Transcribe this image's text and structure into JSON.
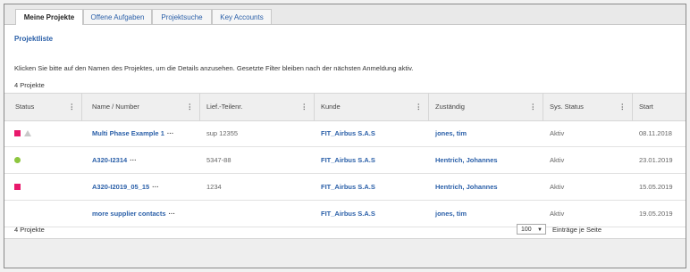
{
  "tabs": [
    "Meine Projekte",
    "Offene Aufgaben",
    "Projektsuche",
    "Key Accounts"
  ],
  "subtitle": "Projektliste",
  "info_text": "Klicken Sie bitte auf den Namen des Projektes, um die Details anzusehen. Gesetzte Filter bleiben nach der nächsten Anmeldung aktiv.",
  "count_text": "4 Projekte",
  "columns": [
    "Status",
    "Name / Number",
    "Lief.-Teilenr.",
    "Kunde",
    "Zuständig",
    "Sys. Status",
    "Start"
  ],
  "menu_glyph": "⋮",
  "more_glyph": "···",
  "colors": {
    "pink": "#e8196c",
    "green": "#8dc63f",
    "link": "#2a5fa8"
  },
  "rows": [
    {
      "status": [
        "pink-square",
        "grey-triangle"
      ],
      "name": "Multi Phase Example 1",
      "part": "sup 12355",
      "customer": "FIT_Airbus S.A.S",
      "owner": "jones, tim",
      "sys_status": "Aktiv",
      "start": "08.11.2018"
    },
    {
      "status": [
        "green-dot"
      ],
      "name": "A320-I2314",
      "part": "5347-88",
      "customer": "FIT_Airbus S.A.S",
      "owner": "Hentrich, Johannes",
      "sys_status": "Aktiv",
      "start": "23.01.2019"
    },
    {
      "status": [
        "pink-square"
      ],
      "name": "A320-I2019_05_15",
      "part": "1234",
      "customer": "FIT_Airbus S.A.S",
      "owner": "Hentrich, Johannes",
      "sys_status": "Aktiv",
      "start": "15.05.2019"
    },
    {
      "status": [],
      "name": "more supplier contacts",
      "part": "",
      "customer": "FIT_Airbus S.A.S",
      "owner": "jones, tim",
      "sys_status": "Aktiv",
      "start": "19.05.2019"
    }
  ],
  "footer": {
    "count": "4 Projekte",
    "page_size": "100",
    "page_size_caret": "▼",
    "page_size_label": "Einträge je Seite"
  }
}
